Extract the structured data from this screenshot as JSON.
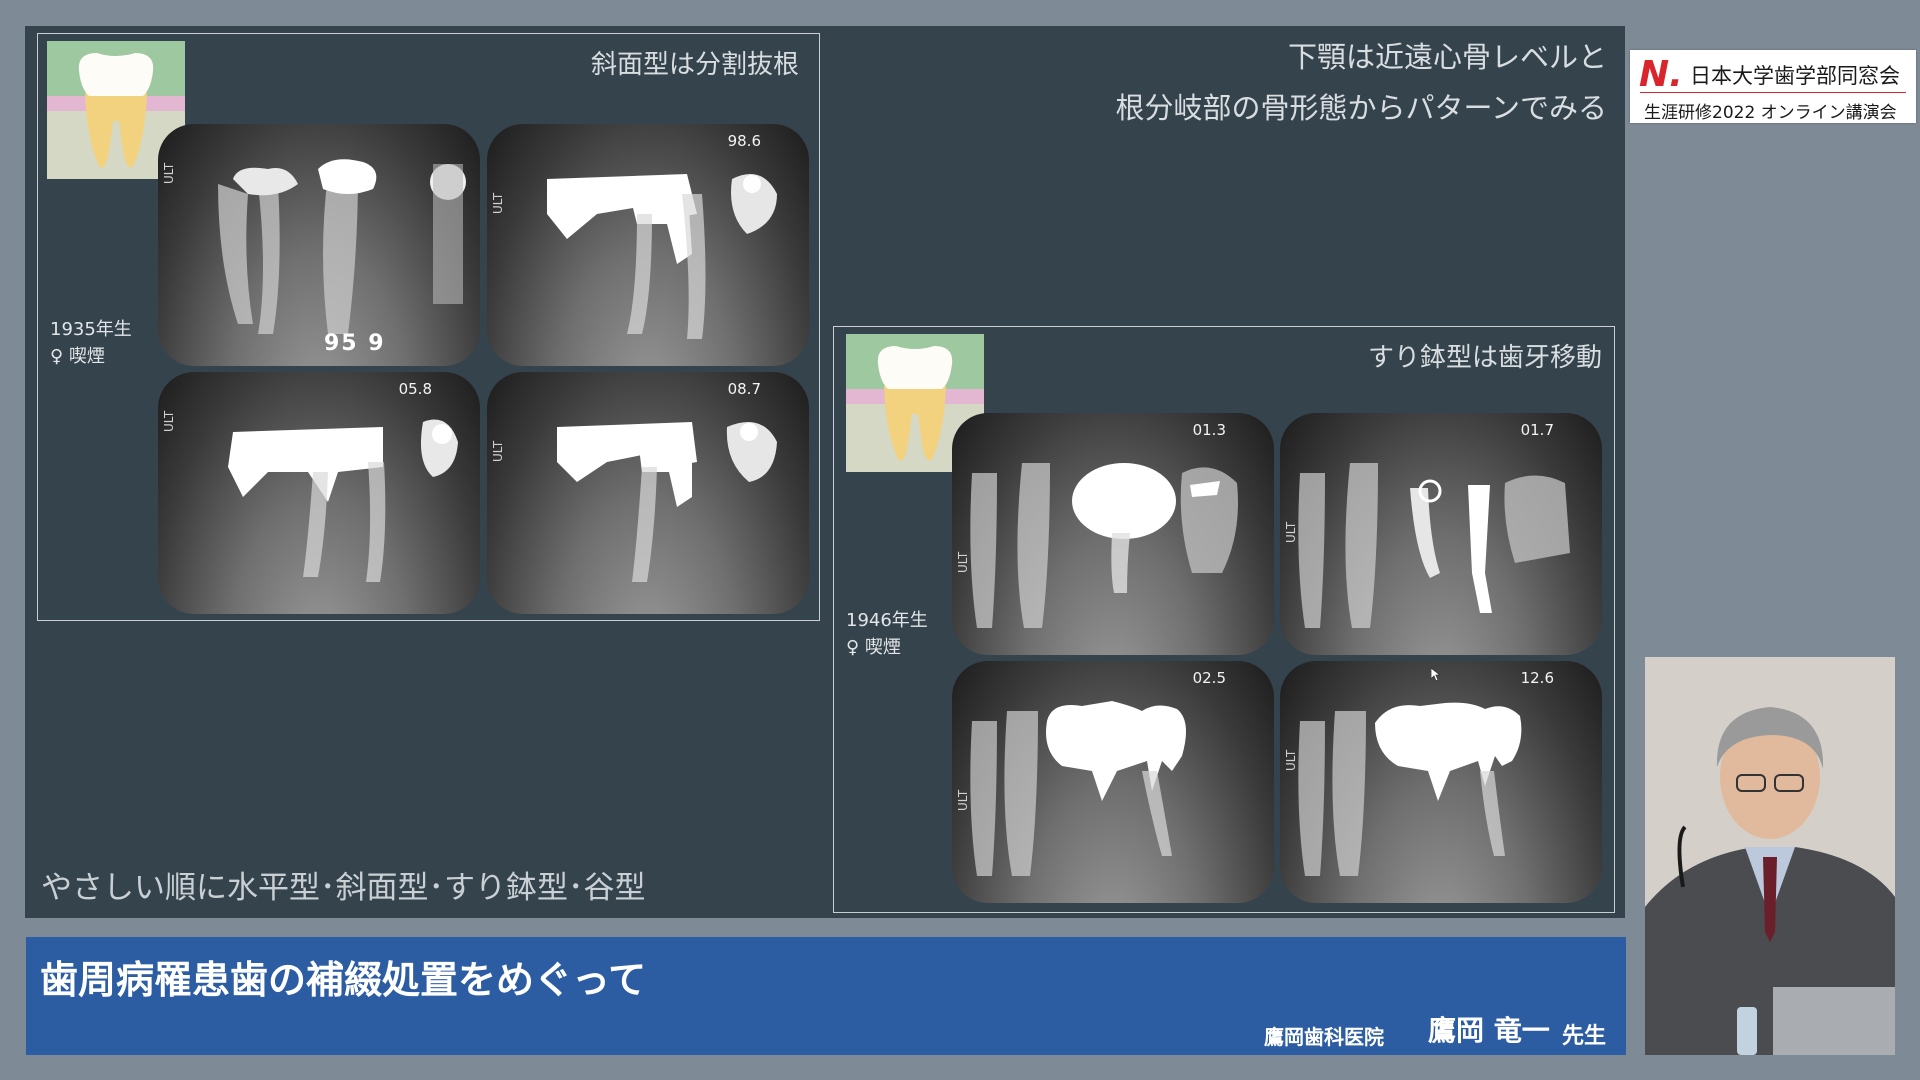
{
  "slide": {
    "heading_right": [
      "下顎は近遠心骨レベルと",
      "根分岐部の骨形態からパターンでみる"
    ],
    "bottom_note": "やさしい順に水平型･斜面型･すり鉢型･谷型",
    "left_panel": {
      "title": "斜面型は分割抜根",
      "patient": [
        "1935年生",
        "♀ 喫煙"
      ],
      "xrays": [
        {
          "date": "",
          "mark": "95 9"
        },
        {
          "date": "98.6",
          "mark": ""
        },
        {
          "date": "05.8",
          "mark": ""
        },
        {
          "date": "08.7",
          "mark": ""
        }
      ]
    },
    "right_panel": {
      "title": "すり鉢型は歯牙移動",
      "patient": [
        "1946年生",
        "♀ 喫煙"
      ],
      "xrays": [
        {
          "date": "01.3"
        },
        {
          "date": "01.7"
        },
        {
          "date": "02.5"
        },
        {
          "date": "12.6"
        }
      ]
    },
    "ult_label": "ULT"
  },
  "logo": {
    "mark": "N.",
    "name": "日本大学歯学部同窓会",
    "event": "生涯研修2022 オンライン講演会"
  },
  "banner": {
    "title": "歯周病罹患歯の補綴処置をめぐって",
    "clinic": "鷹岡歯科医院",
    "speaker": "鷹岡 竜一",
    "suffix": "先生"
  },
  "colors": {
    "slide_bg": "#35434d",
    "banner_bg": "#2c5da3",
    "logo_accent": "#d9262c"
  }
}
